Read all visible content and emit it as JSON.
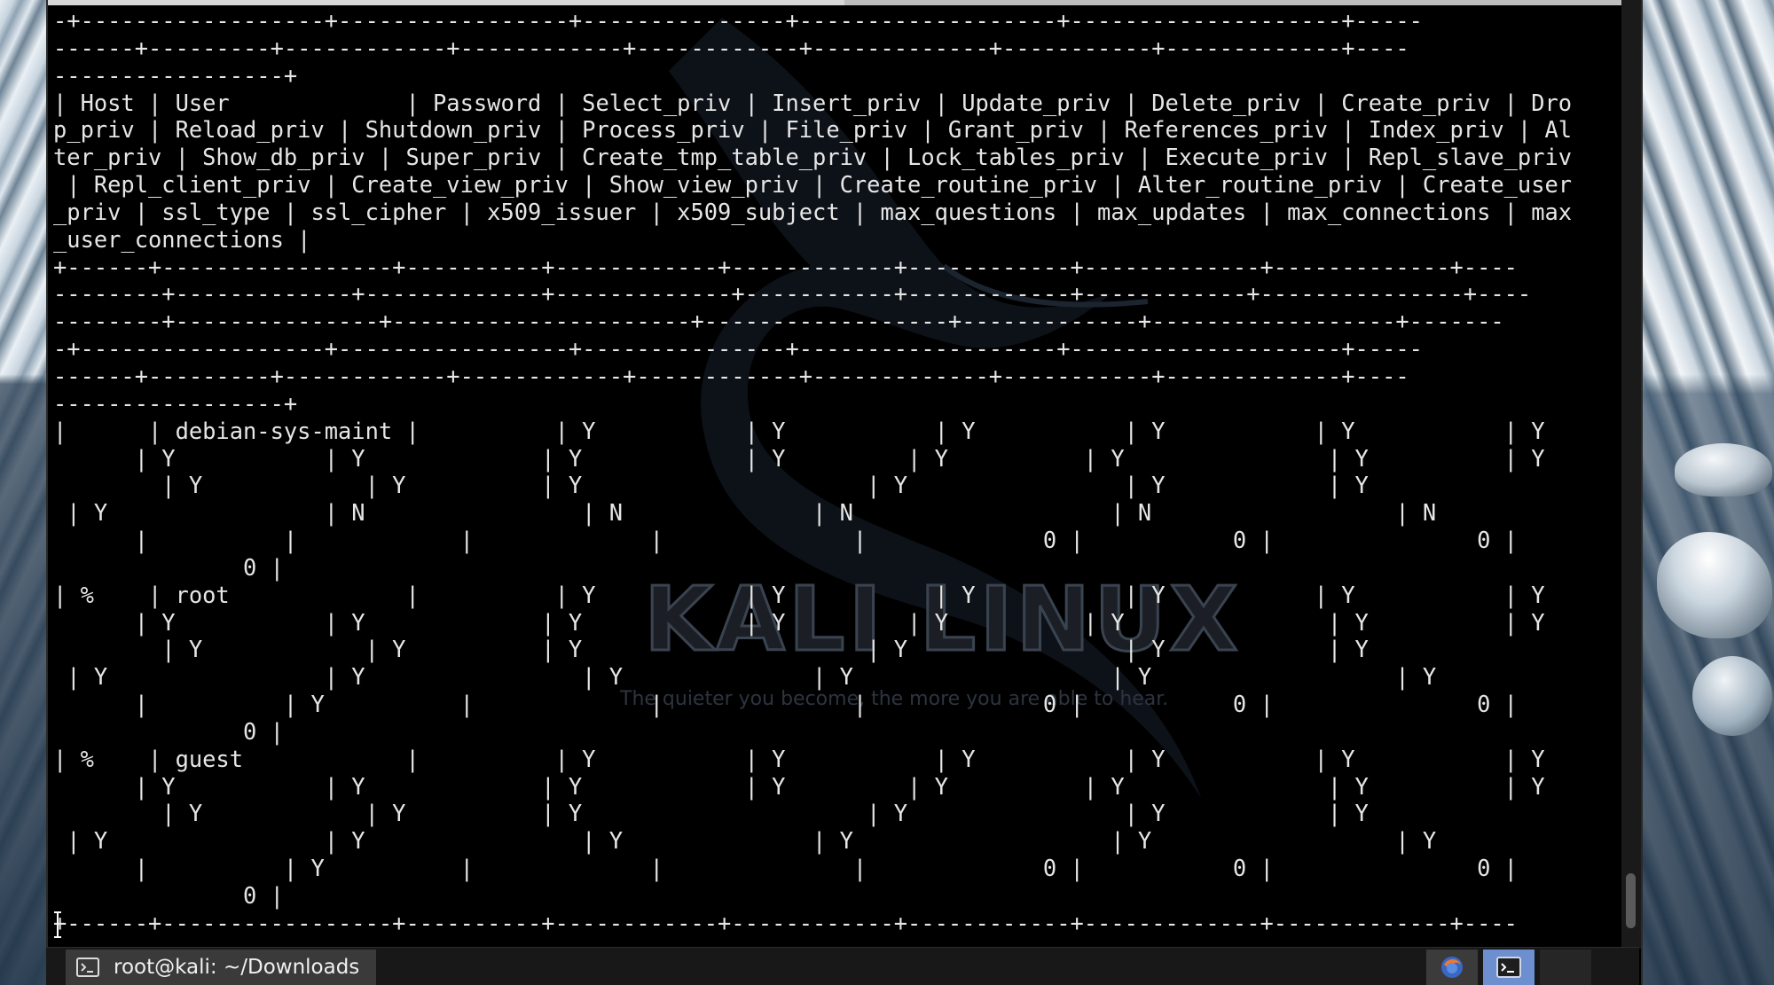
{
  "terminal": {
    "lines": [
      "-+------------------+-----------------+---------------+-------------------+--------------------+-----",
      "------+---------+------------+------------+------------+-------------+-----------+-------------+----",
      "-----------------+",
      "| Host | User             | Password | Select_priv | Insert_priv | Update_priv | Delete_priv | Create_priv | Dro",
      "p_priv | Reload_priv | Shutdown_priv | Process_priv | File_priv | Grant_priv | References_priv | Index_priv | Al",
      "ter_priv | Show_db_priv | Super_priv | Create_tmp_table_priv | Lock_tables_priv | Execute_priv | Repl_slave_priv",
      " | Repl_client_priv | Create_view_priv | Show_view_priv | Create_routine_priv | Alter_routine_priv | Create_user",
      "_priv | ssl_type | ssl_cipher | x509_issuer | x509_subject | max_questions | max_updates | max_connections | max",
      "_user_connections |",
      "+------+-----------------+----------+------------+------------+------------+-------------+-------------+----",
      "--------+-------------+-------------+-------------+-----------+------------+------------+---------------+----",
      "--------+---------------+----------------------+------------------+-------------+------------------+-------",
      "-+------------------+-----------------+---------------+-------------------+--------------------+-----",
      "------+---------+------------+------------+------------+-------------+-----------+-------------+----",
      "-----------------+",
      "|      | debian-sys-maint |          | Y           | Y           | Y           | Y           | Y           | Y",
      "      | Y           | Y             | Y            | Y         | Y          | Y               | Y          | Y",
      "        | Y            | Y          | Y                     | Y                | Y            | Y",
      " | Y                | N                | N              | N                   | N                  | N",
      "      |          |            |             |              |             0 |           0 |               0 |",
      "              0 |",
      "| %    | root             |          | Y           | Y           | Y           | Y           | Y           | Y",
      "      | Y           | Y             | Y            | Y         | Y          | Y               | Y          | Y",
      "        | Y            | Y          | Y                     | Y                | Y            | Y",
      " | Y                | Y                | Y              | Y                   | Y                  | Y",
      "      |          | Y          |             |              |             0 |           0 |               0 |",
      "              0 |",
      "| %    | guest            |          | Y           | Y           | Y           | Y           | Y           | Y",
      "      | Y           | Y             | Y            | Y         | Y          | Y               | Y          | Y",
      "        | Y            | Y          | Y                     | Y                | Y            | Y",
      " | Y                | Y                | Y              | Y                   | Y                  | Y",
      "      |          | Y          |             |              |             0 |           0 |               0 |",
      "              0 |",
      "+------+-----------------+----------+------------+------------+------------+-------------+-------------+----"
    ]
  },
  "watermark": {
    "title": "KALI LINUX",
    "tagline": "The quieter you become, the more you are able to hear."
  },
  "taskbar": {
    "window_title": "root@kali: ~/Downloads",
    "icons": [
      "terminal-icon",
      "browser-icon",
      "terminal-tray-icon"
    ]
  },
  "colors": {
    "terminal_bg": "#000000",
    "terminal_fg": "#e6e6e6",
    "taskbar_bg": "#181818",
    "active_tray": "#6d8fd0"
  }
}
